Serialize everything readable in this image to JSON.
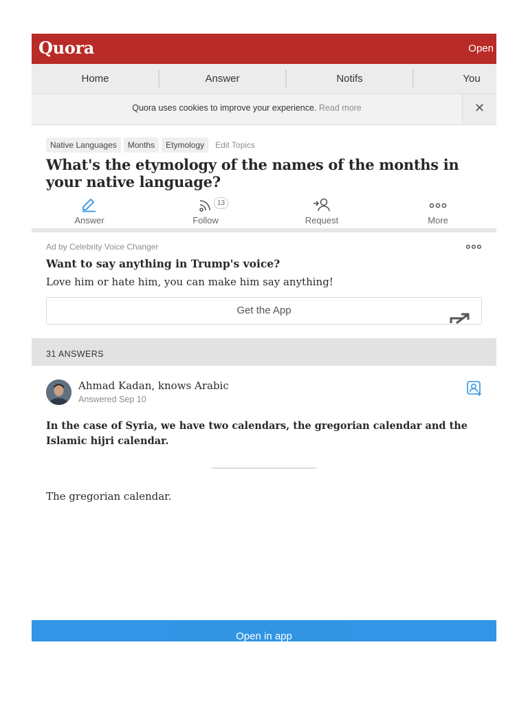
{
  "header": {
    "logo": "Quora",
    "open_label": "Open"
  },
  "nav": {
    "items": [
      "Home",
      "Answer",
      "Notifs",
      "You"
    ]
  },
  "cookie": {
    "message": "Quora uses cookies to improve your experience.",
    "read_more": "Read more",
    "close": "✕"
  },
  "question": {
    "topics": [
      "Native Languages",
      "Months",
      "Etymology"
    ],
    "edit_topics": "Edit Topics",
    "title": "What's the etymology of the names of the months in your native language?",
    "actions": {
      "answer": "Answer",
      "follow": "Follow",
      "follow_count": "13",
      "request": "Request",
      "more": "More"
    }
  },
  "ad": {
    "label": "Ad by Celebrity Voice Changer",
    "title": "Want to say anything in Trump's voice?",
    "body": "Love him or hate him, you can make him say anything!",
    "button": "Get the App"
  },
  "answers": {
    "count_label": "31 ANSWERS",
    "items": [
      {
        "author": "Ahmad Kadan, knows Arabic",
        "date": "Answered Sep 10",
        "bold_text": "In the case of Syria, we have two calendars, the gregorian calendar and the Islamic hijri calendar.",
        "text": "The gregorian calendar."
      }
    ]
  },
  "footer": {
    "open_in_app": "Open in app"
  },
  "colors": {
    "brand": "#b92b27",
    "accent": "#2b92e4",
    "link_blue": "#2e69ff"
  }
}
